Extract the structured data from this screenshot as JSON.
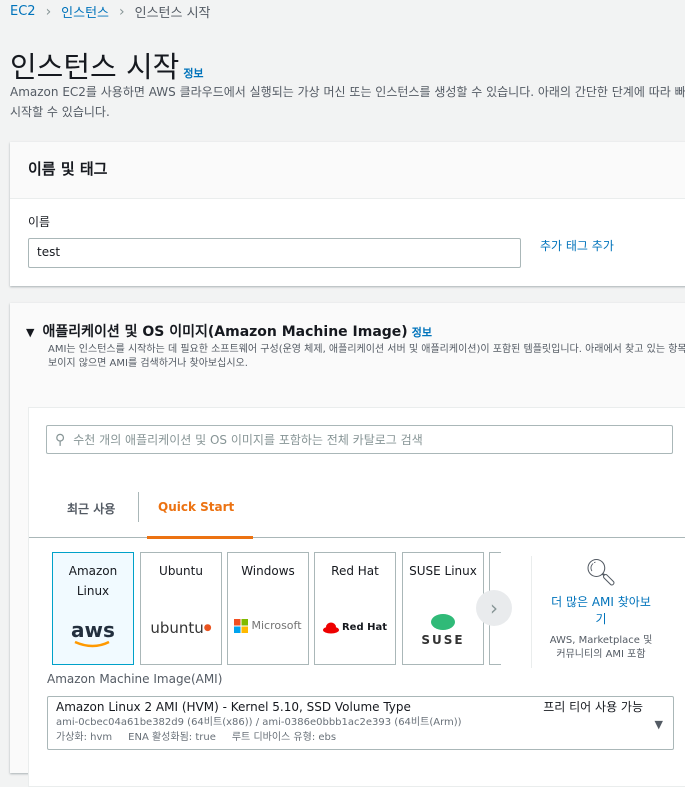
{
  "breadcrumb": [
    "EC2",
    "인스턴스",
    "인스턴스 시작"
  ],
  "page": {
    "title": "인스턴스 시작",
    "info": "정보",
    "description": "Amazon EC2를 사용하면 AWS 클라우드에서 실행되는 가상 머신 또는 인스턴스를 생성할 수 있습니다. 아래의 간단한 단계에 따라 빠르게 시작할 수 있습니다."
  },
  "name_tags": {
    "header": "이름 및 태그",
    "name_label": "이름",
    "name_value": "test",
    "add_tags": "추가 태그 추가"
  },
  "ami": {
    "header": "애플리케이션 및 OS 이미지(Amazon Machine Image)",
    "info": "정보",
    "description": "AMI는 인스턴스를 시작하는 데 필요한 소프트웨어 구성(운영 체제, 애플리케이션 서버 및 애플리케이션)이 포함된 템플릿입니다. 아래에서 찾고 있는 항목이 보이지 않으면 AMI를 검색하거나 찾아보십시오.",
    "search_placeholder": "수천 개의 애플리케이션 및 OS 이미지를 포함하는 전체 카탈로그 검색",
    "tabs": [
      "최근 사용",
      "Quick Start"
    ],
    "cards": [
      {
        "name": "Amazon Linux",
        "logo": "aws"
      },
      {
        "name": "Ubuntu",
        "logo": "ubuntu"
      },
      {
        "name": "Windows",
        "logo": "Microsoft"
      },
      {
        "name": "Red Hat",
        "logo": "Red Hat"
      },
      {
        "name": "SUSE Linux",
        "logo": "SUSE"
      }
    ],
    "browse_more": "더 많은 AMI 찾아보기",
    "browse_sub": "AWS, Marketplace 및 커뮤니티의 AMI 포함",
    "select_label": "Amazon Machine Image(AMI)",
    "selected": {
      "title": "Amazon Linux 2 AMI (HVM) - Kernel 5.10, SSD Volume Type",
      "badge": "프리 티어 사용 가능",
      "ids": "ami-0cbec04a61be382d9 (64비트(x86)) / ami-0386e0bbb1ac2e393 (64비트(Arm))",
      "virt": "가상화: hvm",
      "ena": "ENA 활성화됨: true",
      "root": "루트 디바이스 유형: ebs"
    }
  },
  "colors": {
    "accent": "#ec7211",
    "link": "#0073bb"
  }
}
